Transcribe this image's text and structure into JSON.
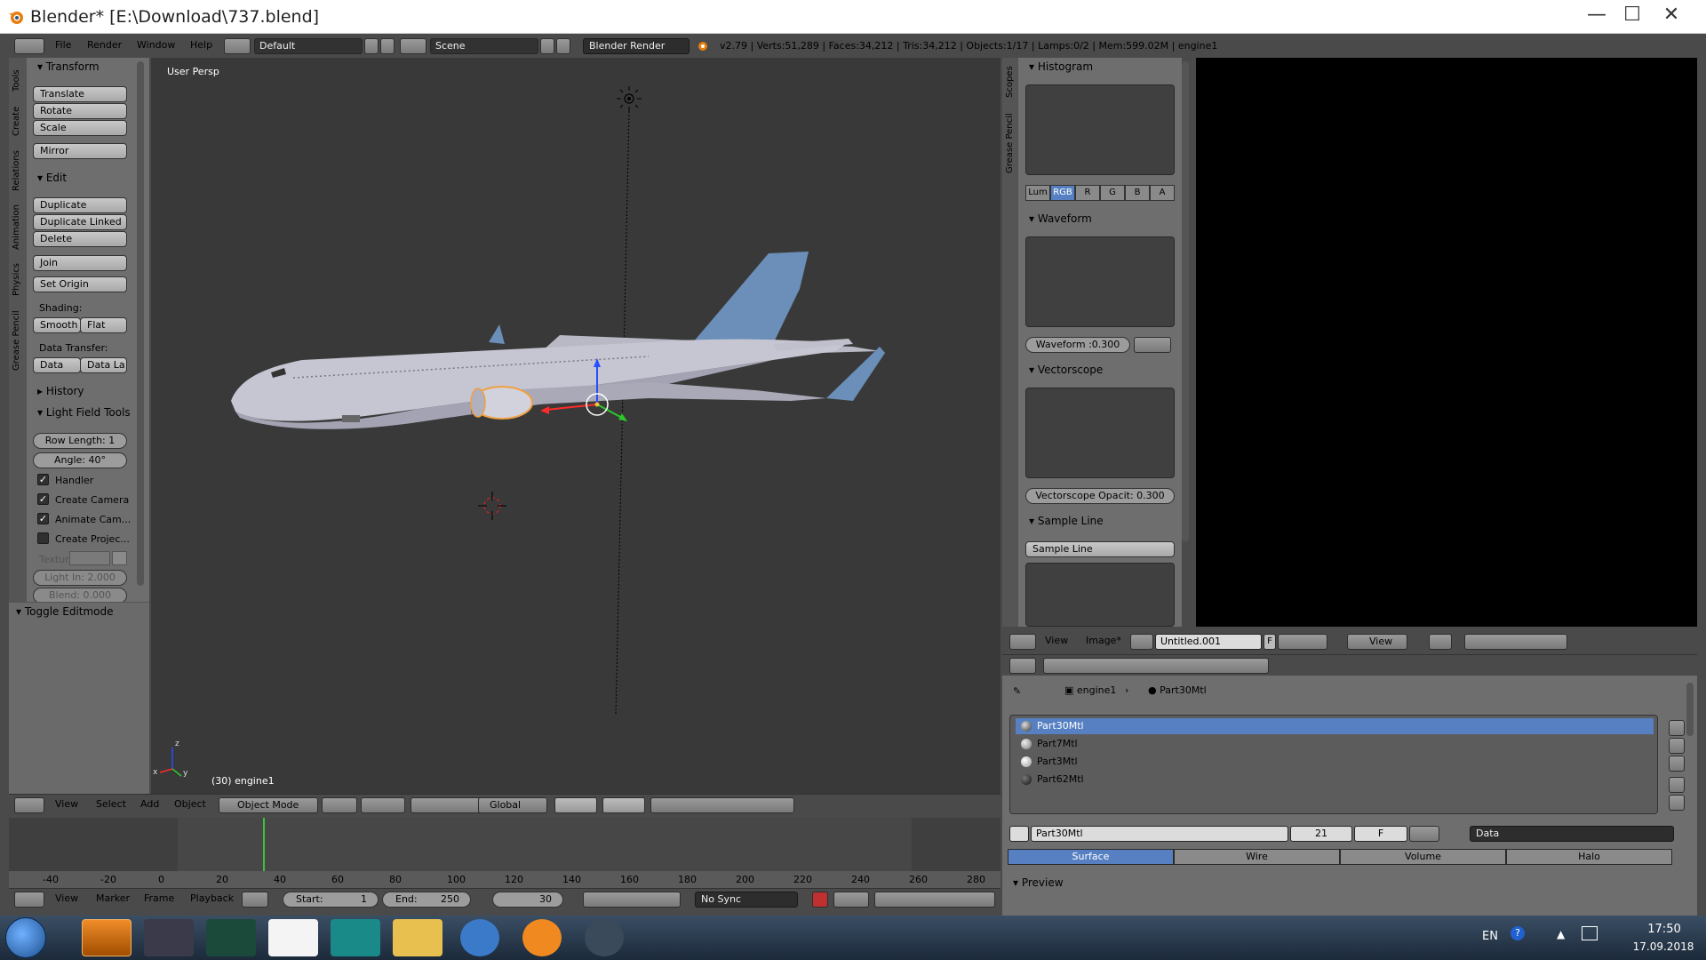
{
  "window": {
    "title": "Blender* [E:\\Download\\737.blend]"
  },
  "info_header": {
    "menus": [
      "File",
      "Render",
      "Window",
      "Help"
    ],
    "layout": "Default",
    "scene": "Scene",
    "engine": "Blender Render",
    "stats": "v2.79 | Verts:51,289 | Faces:34,212 | Tris:34,212 | Objects:1/17 | Lamps:0/2 | Mem:599.02M | engine1"
  },
  "tool_tabs": [
    "Tools",
    "Create",
    "Relations",
    "Animation",
    "Physics",
    "Grease Pencil"
  ],
  "tools": {
    "transform_header": "Transform",
    "translate": "Translate",
    "rotate": "Rotate",
    "scale": "Scale",
    "mirror": "Mirror",
    "edit_header": "Edit",
    "duplicate": "Duplicate",
    "duplicate_linked": "Duplicate Linked",
    "delete": "Delete",
    "join": "Join",
    "set_origin": "Set Origin",
    "shading_label": "Shading:",
    "smooth": "Smooth",
    "flat": "Flat",
    "data_transfer_label": "Data Transfer:",
    "data": "Data",
    "data_la": "Data La",
    "history_header": "History",
    "lft_header": "Light Field Tools",
    "row_length": "Row Length:  1",
    "angle": "Angle:        40°",
    "handler": "Handler",
    "create_camera": "Create Camera",
    "animate_cam": "Animate Cam...",
    "create_projec": "Create Projec...",
    "textur": "Textur",
    "light_in": "Light In: 2.000",
    "blend": "Blend:    0.000",
    "toggle_editmode": "Toggle Editmode"
  },
  "viewport": {
    "label": "User Persp",
    "object_label": "(30) engine1",
    "axis_x": "x",
    "axis_y": "y",
    "axis_z": "z"
  },
  "view3d_header": {
    "menus": [
      "View",
      "Select",
      "Add",
      "Object"
    ],
    "mode": "Object Mode",
    "orientation": "Global"
  },
  "timeline": {
    "ruler": [
      "-40",
      "-20",
      "0",
      "20",
      "40",
      "60",
      "80",
      "100",
      "120",
      "140",
      "160",
      "180",
      "200",
      "220",
      "240",
      "260",
      "280"
    ],
    "menus": [
      "View",
      "Marker",
      "Frame",
      "Playback"
    ],
    "start": "Start:",
    "start_val": "1",
    "end": "End:",
    "end_val": "250",
    "current": "30",
    "sync": "No Sync"
  },
  "scopes": {
    "tabs": [
      "Scopes",
      "Grease Pencil"
    ],
    "histogram": "Histogram",
    "channels": [
      "Lum",
      "RGB",
      "R",
      "G",
      "B",
      "A"
    ],
    "waveform": "Waveform",
    "waveform_opacity": "Waveform :0.300",
    "vectorscope": "Vectorscope",
    "vectorscope_opacity": "Vectorscope Opacit: 0.300",
    "sample_line": "Sample Line",
    "sample_line_btn": "Sample Line"
  },
  "image_editor_header": {
    "menus": [
      "View",
      "Image*"
    ],
    "image_name": "Untitled.001",
    "fake_user": "F",
    "view": "View"
  },
  "properties": {
    "breadcrumb_object": "engine1",
    "breadcrumb_material": "Part30Mtl",
    "materials": [
      "Part30Mtl",
      "Part7Mtl",
      "Part3Mtl",
      "Part62Mtl"
    ],
    "material_name": "Part30Mtl",
    "users": "21",
    "fake": "F",
    "link": "Data",
    "tabs": [
      "Surface",
      "Wire",
      "Volume",
      "Halo"
    ],
    "preview": "Preview"
  },
  "taskbar": {
    "lang": "EN",
    "time": "17:50",
    "date": "17.09.2018"
  }
}
